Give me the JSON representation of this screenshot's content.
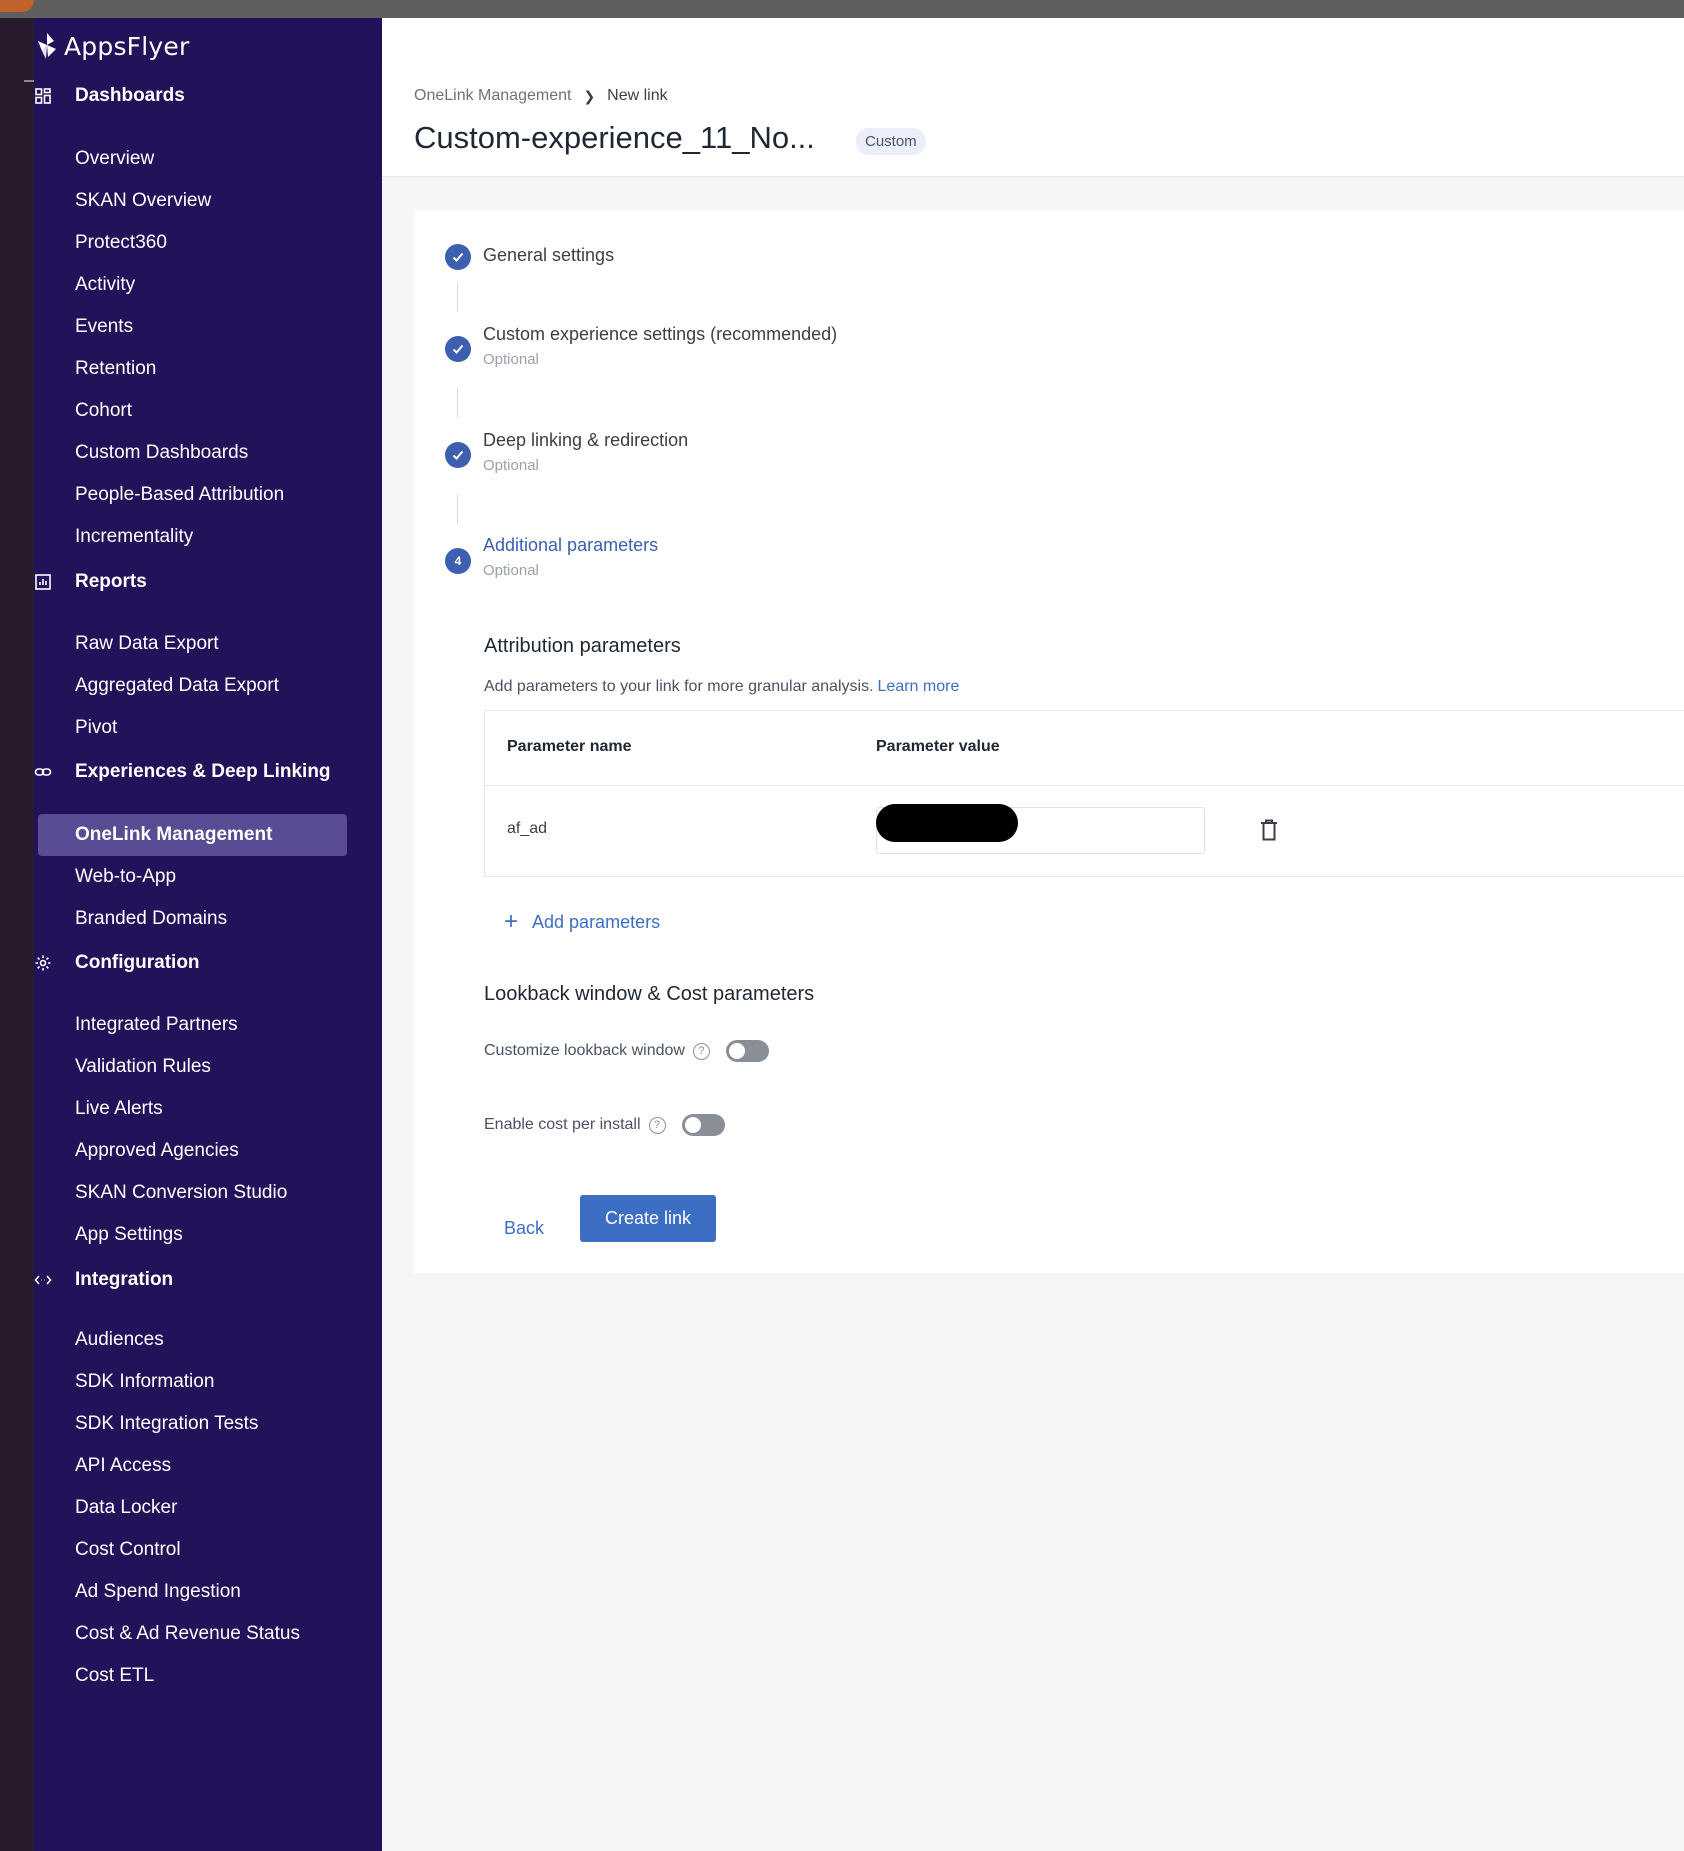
{
  "brand": {
    "name": "AppsFlyer"
  },
  "sidebar": {
    "sections": [
      {
        "label": "Dashboards",
        "icon": "grid-icon",
        "items": [
          "Overview",
          "SKAN Overview",
          "Protect360",
          "Activity",
          "Events",
          "Retention",
          "Cohort",
          "Custom Dashboards",
          "People-Based Attribution",
          "Incrementality"
        ]
      },
      {
        "label": "Reports",
        "icon": "bar-chart-icon",
        "items": [
          "Raw Data Export",
          "Aggregated Data Export",
          "Pivot"
        ]
      },
      {
        "label": "Experiences & Deep Linking",
        "icon": "link-icon",
        "items": [
          "OneLink Management",
          "Web-to-App",
          "Branded Domains"
        ],
        "active": "OneLink Management"
      },
      {
        "label": "Configuration",
        "icon": "gear-icon",
        "items": [
          "Integrated Partners",
          "Validation Rules",
          "Live Alerts",
          "Approved Agencies",
          "SKAN Conversion Studio",
          "App Settings"
        ]
      },
      {
        "label": "Integration",
        "icon": "code-arrows-icon",
        "items": [
          "Audiences",
          "SDK Information",
          "SDK Integration Tests",
          "API Access",
          "Data Locker",
          "Cost Control",
          "Ad Spend Ingestion",
          "Cost & Ad Revenue Status",
          "Cost ETL"
        ]
      }
    ]
  },
  "header": {
    "breadcrumb": {
      "parent": "OneLink Management",
      "current": "New link"
    },
    "title": "Custom-experience_11_No...",
    "badge": "Custom"
  },
  "steps": [
    {
      "number": "",
      "title": "General settings",
      "sub": "",
      "state": "done"
    },
    {
      "number": "",
      "title": "Custom experience settings (recommended)",
      "sub": "Optional",
      "state": "done"
    },
    {
      "number": "",
      "title": "Deep linking & redirection",
      "sub": "Optional",
      "state": "done"
    },
    {
      "number": "4",
      "title": "Additional parameters",
      "sub": "Optional",
      "state": "active"
    }
  ],
  "attribution": {
    "title": "Attribution parameters",
    "description": "Add parameters to your link for more granular analysis.",
    "learn_more": "Learn more",
    "columns": [
      "Parameter name",
      "Parameter value"
    ],
    "rows": [
      {
        "name": "af_ad",
        "value": ""
      }
    ],
    "add_label": "Add parameters"
  },
  "lookback": {
    "title": "Lookback window & Cost parameters",
    "customize_label": "Customize lookback window",
    "customize_enabled": false,
    "cpi_label": "Enable cost per install",
    "cpi_enabled": false
  },
  "actions": {
    "back": "Back",
    "create": "Create link"
  },
  "colors": {
    "sidebar": "#22125a",
    "active_item": "#5a4b95",
    "accent": "#3c6fc4",
    "step": "#3c5fb0"
  }
}
